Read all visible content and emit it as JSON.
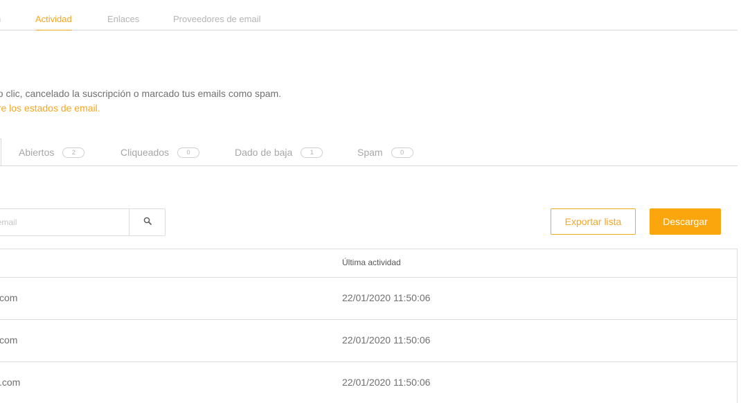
{
  "top_tabs": {
    "cut_label": "n",
    "activity": "Actividad",
    "links": "Enlaces",
    "providers": "Proveedores de email"
  },
  "description": {
    "line1": "no clic, cancelado la suscripción o marcado tus emails como spam.",
    "link": "bre los estados de email."
  },
  "status_tabs": [
    {
      "label": "Abiertos",
      "count": "2"
    },
    {
      "label": "Cliqueados",
      "count": "0"
    },
    {
      "label": "Dado de baja",
      "count": "1"
    },
    {
      "label": "Spam",
      "count": "0"
    }
  ],
  "search": {
    "placeholder": "de email",
    "icon": "search-icon"
  },
  "actions": {
    "export": "Exportar lista",
    "download": "Descargar"
  },
  "table": {
    "header_activity": "Última actividad",
    "rows": [
      {
        "email": "com",
        "last_activity": "22/01/2020 11:50:06"
      },
      {
        "email": "com",
        "last_activity": "22/01/2020 11:50:06"
      },
      {
        "email": ".com",
        "last_activity": "22/01/2020 11:50:06"
      }
    ]
  },
  "colors": {
    "accent": "#f5a623",
    "button_fill": "#fca60d",
    "border": "#dcdcdc"
  }
}
